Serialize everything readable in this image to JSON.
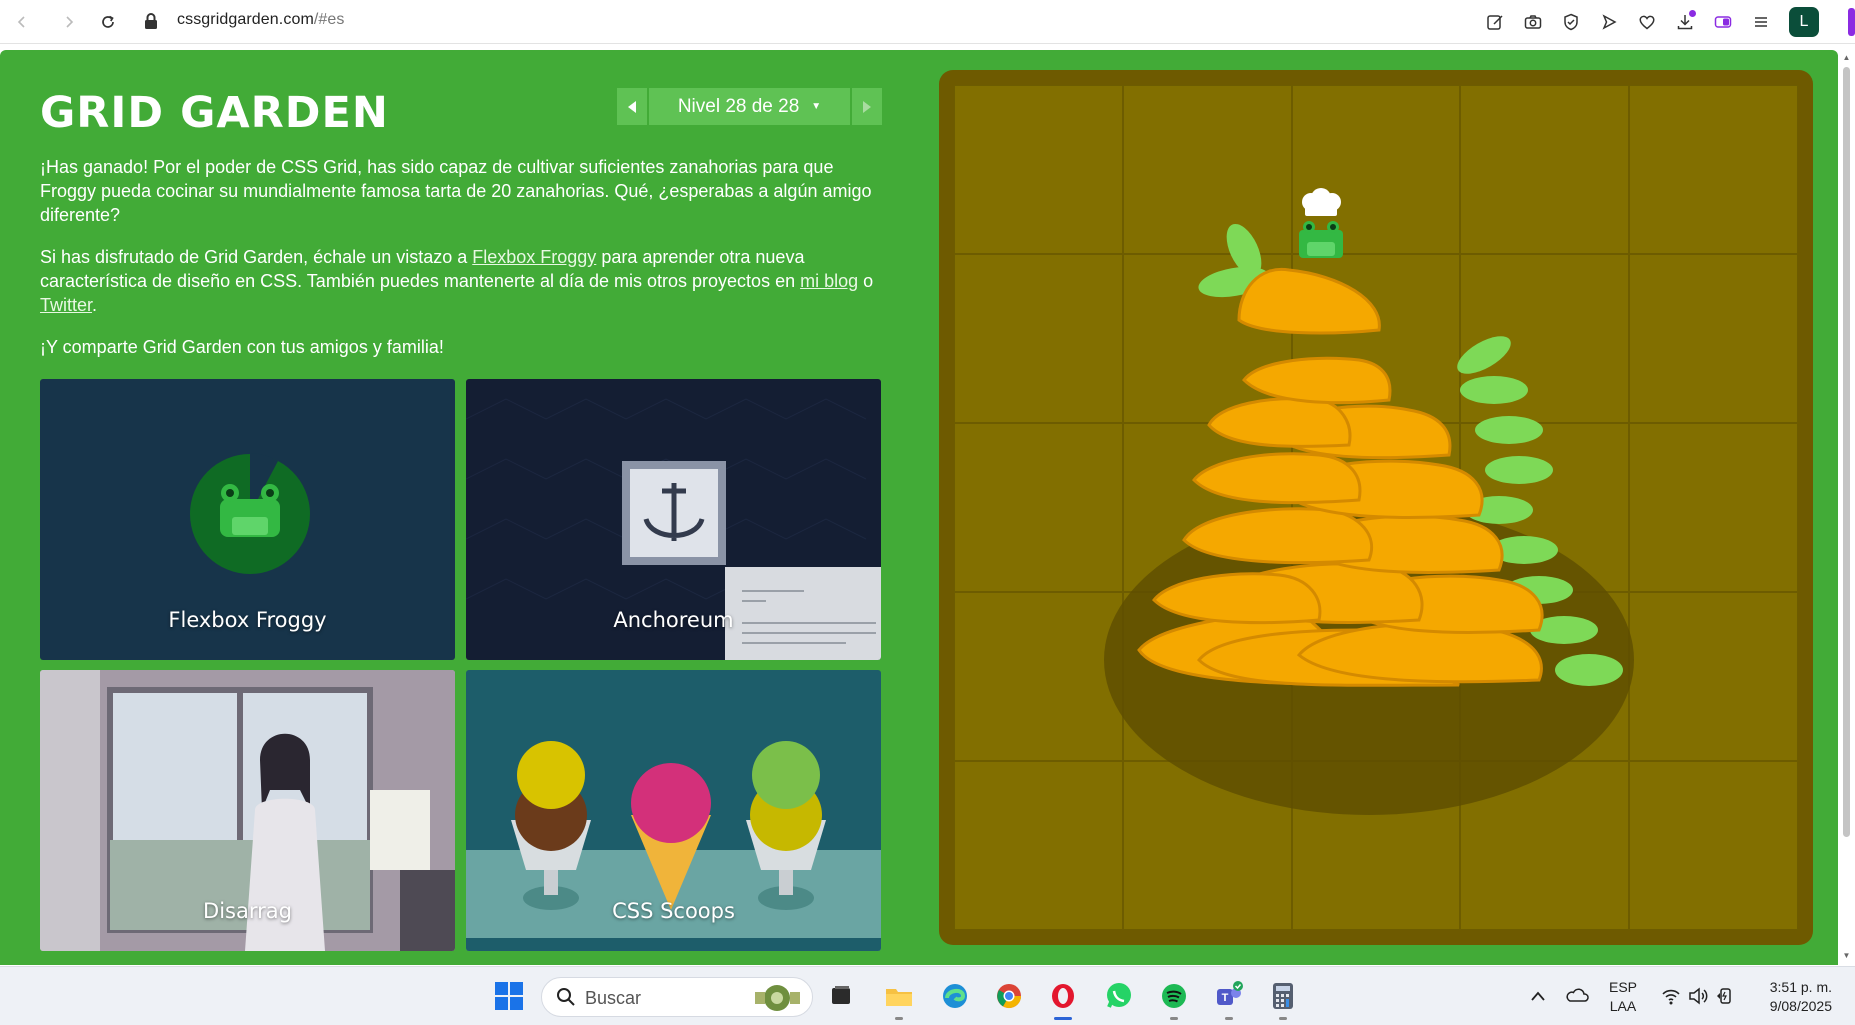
{
  "browser": {
    "url_domain": "cssgridgarden.com",
    "url_hash": "/#es",
    "profile_initial": "L",
    "toolbar_icons": [
      "edit-icon",
      "camera-icon",
      "shield-icon",
      "play-icon",
      "heart-icon",
      "download-icon",
      "toggle-icon",
      "menu-icon"
    ]
  },
  "page": {
    "title": "GRID GARDEN",
    "level_label": "Nivel 28 de 28",
    "paragraph1": "¡Has ganado! Por el poder de CSS Grid, has sido capaz de cultivar suficientes zanahorias para que Froggy pueda cocinar su mundialmente famosa tarta de 20 zanahorias. Qué, ¿esperabas a algún amigo diferente?",
    "paragraph2_a": "Si has disfrutado de Grid Garden, échale un vistazo a ",
    "paragraph2_link1": "Flexbox Froggy",
    "paragraph2_b": " para aprender otra nueva característica de diseño en CSS. También puedes mantenerte al día de mis otros proyectos en ",
    "paragraph2_link2": "mi blog",
    "paragraph2_c": " o ",
    "paragraph2_link3": "Twitter",
    "paragraph2_d": ".",
    "paragraph3": "¡Y comparte Grid Garden con tus amigos y familia!",
    "cards": [
      {
        "label": "Flexbox Froggy"
      },
      {
        "label": "Anchoreum"
      },
      {
        "label": "Disarrag"
      },
      {
        "label": "CSS Scoops"
      }
    ]
  },
  "taskbar": {
    "search_placeholder": "Buscar",
    "lang_line1": "ESP",
    "lang_line2": "LAA",
    "time": "3:51 p. m.",
    "date": "9/08/2025"
  },
  "colors": {
    "page_bg": "#42ab37",
    "garden_border": "#6e5a00",
    "soil": "#826f00",
    "carrot": "#f5a800",
    "leaf": "#7ed957"
  }
}
